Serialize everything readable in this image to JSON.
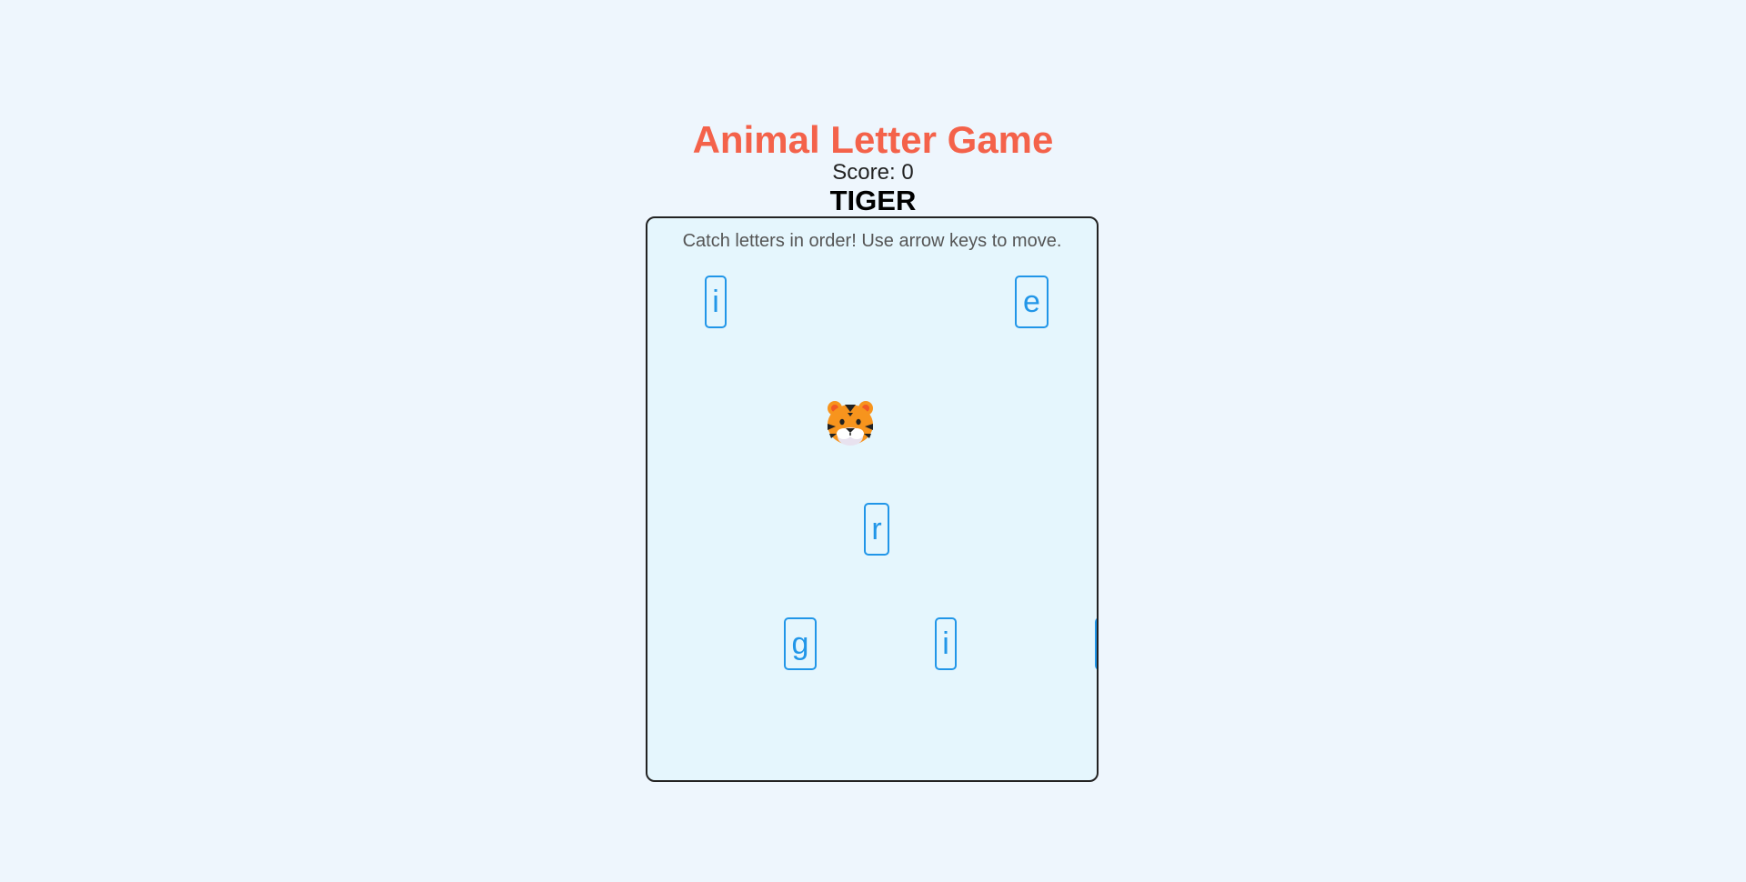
{
  "game": {
    "title": "Animal Letter Game",
    "score_text": "Score: 0",
    "target_word": "TIGER",
    "instructions": "Catch letters in order! Use arrow keys to move."
  },
  "letters": [
    "i",
    "e",
    "r",
    "g",
    "i",
    ""
  ],
  "player": {
    "icon": "tiger-face-icon"
  },
  "colors": {
    "background": "#eef6fd",
    "board": "#e5f6fd",
    "title": "#f4624a",
    "tile": "#2196e8",
    "border": "#222222"
  }
}
